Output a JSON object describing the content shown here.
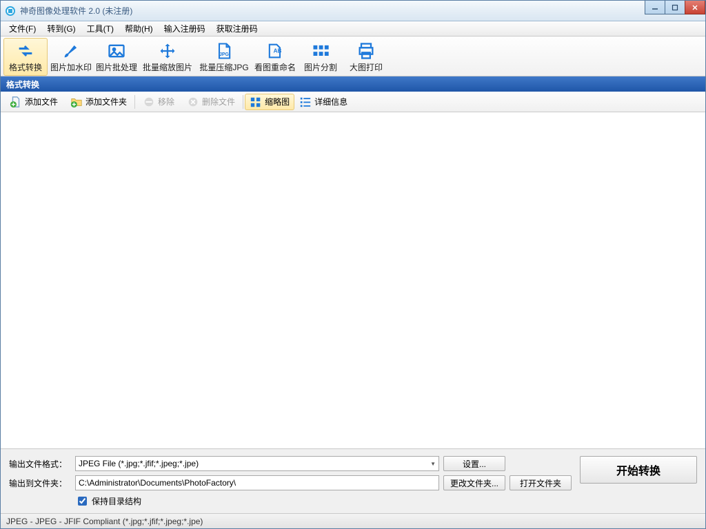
{
  "title": "神奇图像处理软件 2.0 (未注册)",
  "menu": {
    "file": "文件(F)",
    "goto": "转到(G)",
    "tools": "工具(T)",
    "help": "帮助(H)",
    "enter_reg": "输入注册码",
    "get_reg": "获取注册码"
  },
  "toolbar": [
    {
      "name": "format-convert",
      "label": "格式转换"
    },
    {
      "name": "add-watermark",
      "label": "图片加水印"
    },
    {
      "name": "batch-process",
      "label": "图片批处理"
    },
    {
      "name": "batch-resize",
      "label": "批量缩放图片"
    },
    {
      "name": "batch-compress-jpg",
      "label": "批量压缩JPG"
    },
    {
      "name": "rename-by-view",
      "label": "看图重命名"
    },
    {
      "name": "image-split",
      "label": "图片分割"
    },
    {
      "name": "big-print",
      "label": "大图打印"
    }
  ],
  "section_title": "格式转换",
  "sub": {
    "add_file": "添加文件",
    "add_folder": "添加文件夹",
    "remove": "移除",
    "remove_files": "删除文件",
    "thumb": "缩略图",
    "detail": "详细信息"
  },
  "form": {
    "out_format_label": "输出文件格式：",
    "out_format_value": "JPEG File (*.jpg;*.jfif;*.jpeg;*.jpe)",
    "settings": "设置...",
    "out_folder_label": "输出到文件夹：",
    "out_folder_value": "C:\\Administrator\\Documents\\PhotoFactory\\",
    "change_folder": "更改文件夹...",
    "open_folder": "打开文件夹",
    "keep_dir": "保持目录结构"
  },
  "start_button": "开始转换",
  "status": "JPEG - JPEG - JFIF Compliant (*.jpg;*.jfif;*.jpeg;*.jpe)"
}
